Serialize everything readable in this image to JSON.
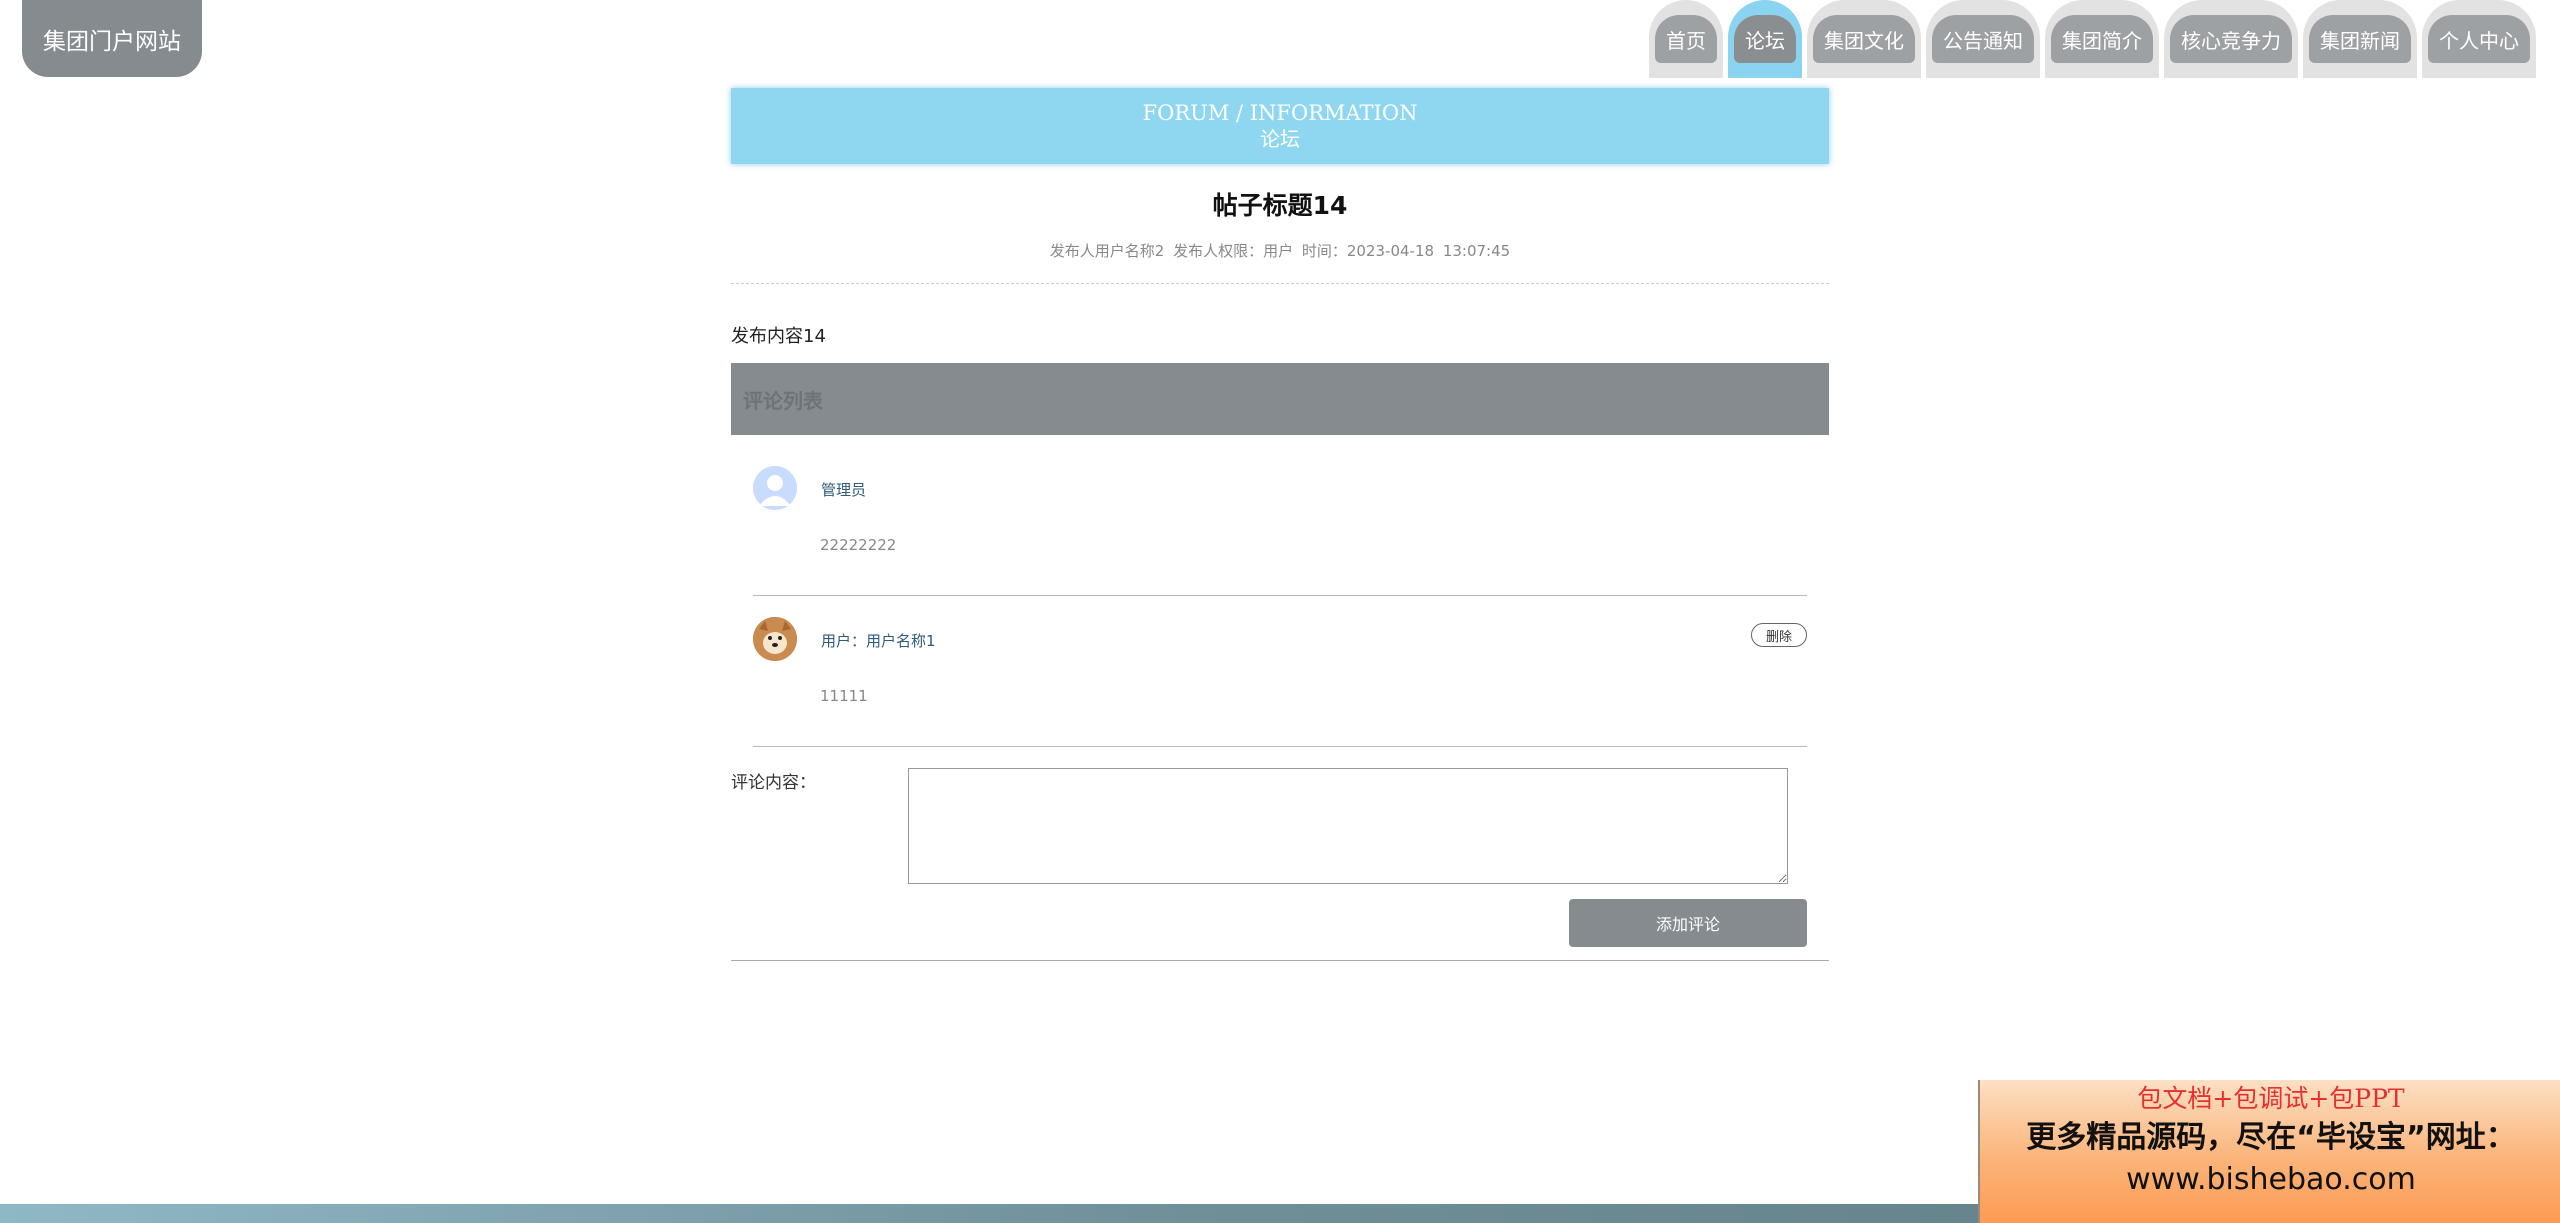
{
  "site": {
    "title": "集团门户网站"
  },
  "nav": {
    "items": [
      {
        "label": "首页"
      },
      {
        "label": "论坛",
        "active": true
      },
      {
        "label": "集团文化"
      },
      {
        "label": "公告通知"
      },
      {
        "label": "集团简介"
      },
      {
        "label": "核心竞争力"
      },
      {
        "label": "集团新闻"
      },
      {
        "label": "个人中心"
      }
    ]
  },
  "banner": {
    "en": "FORUM / INFORMATION",
    "cn": "论坛"
  },
  "post": {
    "title": "帖子标题14",
    "meta": "发布人用户名称2   发布人权限：用户   时间：2023-04-18 13:07:45",
    "content": "发布内容14"
  },
  "comments": {
    "header": "评论列表",
    "items": [
      {
        "name": "管理员",
        "text": "22222222",
        "avatar": "user-silhouette-icon"
      },
      {
        "name": "用户：用户名称1",
        "text": "11111",
        "avatar": "dog-photo",
        "delete_label": "删除"
      }
    ]
  },
  "form": {
    "label": "评论内容：",
    "textarea_value": "",
    "submit_label": "添加评论"
  },
  "ad": {
    "line1": "包文档+包调试+包PPT",
    "line2": "更多精品源码，尽在“毕设宝”网址：",
    "line3": "www.bishebao.com"
  },
  "colors": {
    "accent_blue": "#8fd7f1",
    "gray_primary": "#858b8e",
    "link_blue": "#2f5a78"
  }
}
